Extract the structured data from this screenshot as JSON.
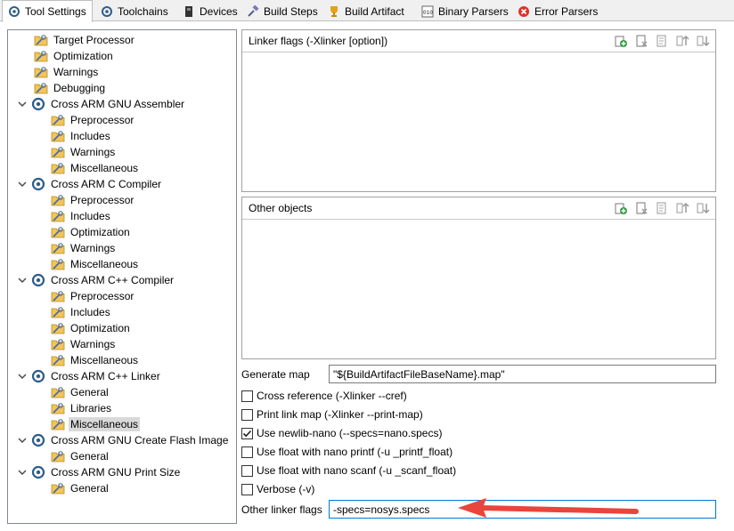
{
  "tabs": [
    {
      "label": "Tool Settings",
      "icon": "tool-settings-icon"
    },
    {
      "label": "Toolchains",
      "icon": "toolchains-icon"
    },
    {
      "label": "Devices",
      "icon": "devices-icon"
    },
    {
      "label": "Build Steps",
      "icon": "build-steps-icon"
    },
    {
      "label": "Build Artifact",
      "icon": "build-artifact-icon"
    },
    {
      "label": "Binary Parsers",
      "icon": "binary-parsers-icon"
    },
    {
      "label": "Error Parsers",
      "icon": "error-parsers-icon"
    }
  ],
  "tree": {
    "items": [
      {
        "label": "Target Processor",
        "type": "folder"
      },
      {
        "label": "Optimization",
        "type": "folder"
      },
      {
        "label": "Warnings",
        "type": "folder"
      },
      {
        "label": "Debugging",
        "type": "folder"
      },
      {
        "label": "Cross ARM GNU Assembler",
        "type": "tool"
      },
      {
        "label": "Preprocessor",
        "type": "folder"
      },
      {
        "label": "Includes",
        "type": "folder"
      },
      {
        "label": "Warnings",
        "type": "folder"
      },
      {
        "label": "Miscellaneous",
        "type": "folder"
      },
      {
        "label": "Cross ARM C Compiler",
        "type": "tool"
      },
      {
        "label": "Preprocessor",
        "type": "folder"
      },
      {
        "label": "Includes",
        "type": "folder"
      },
      {
        "label": "Optimization",
        "type": "folder"
      },
      {
        "label": "Warnings",
        "type": "folder"
      },
      {
        "label": "Miscellaneous",
        "type": "folder"
      },
      {
        "label": "Cross ARM C++ Compiler",
        "type": "tool"
      },
      {
        "label": "Preprocessor",
        "type": "folder"
      },
      {
        "label": "Includes",
        "type": "folder"
      },
      {
        "label": "Optimization",
        "type": "folder"
      },
      {
        "label": "Warnings",
        "type": "folder"
      },
      {
        "label": "Miscellaneous",
        "type": "folder"
      },
      {
        "label": "Cross ARM C++ Linker",
        "type": "tool"
      },
      {
        "label": "General",
        "type": "folder"
      },
      {
        "label": "Libraries",
        "type": "folder"
      },
      {
        "label": "Miscellaneous",
        "type": "folder",
        "selected": true
      },
      {
        "label": "Cross ARM GNU Create Flash Image",
        "type": "tool"
      },
      {
        "label": "General",
        "type": "folder"
      },
      {
        "label": "Cross ARM GNU Print Size",
        "type": "tool"
      },
      {
        "label": "General",
        "type": "folder"
      }
    ]
  },
  "linker_flags": {
    "title": "Linker flags (-Xlinker [option])",
    "toolbar_icons": [
      "add-icon",
      "delete-icon",
      "edit-icon",
      "move-up-icon",
      "move-down-icon"
    ]
  },
  "other_objects": {
    "title": "Other objects",
    "toolbar_icons": [
      "add-icon",
      "delete-icon",
      "edit-icon",
      "move-up-icon",
      "move-down-icon"
    ]
  },
  "generate_map": {
    "label": "Generate map",
    "value": "\"${BuildArtifactFileBaseName}.map\""
  },
  "options": [
    {
      "label": "Cross reference (-Xlinker --cref)",
      "checked": false
    },
    {
      "label": "Print link map (-Xlinker --print-map)",
      "checked": false
    },
    {
      "label": "Use newlib-nano (--specs=nano.specs)",
      "checked": true
    },
    {
      "label": "Use float with nano printf (-u _printf_float)",
      "checked": false
    },
    {
      "label": "Use float with nano scanf (-u _scanf_float)",
      "checked": false
    },
    {
      "label": "Verbose (-v)",
      "checked": false
    }
  ],
  "other_linker_flags": {
    "label": "Other linker flags",
    "value": "-specs=nosys.specs"
  },
  "colors": {
    "annotation_arrow": "#e8453c",
    "focus_border": "#0078d7",
    "selection": "#d9d9d9"
  }
}
